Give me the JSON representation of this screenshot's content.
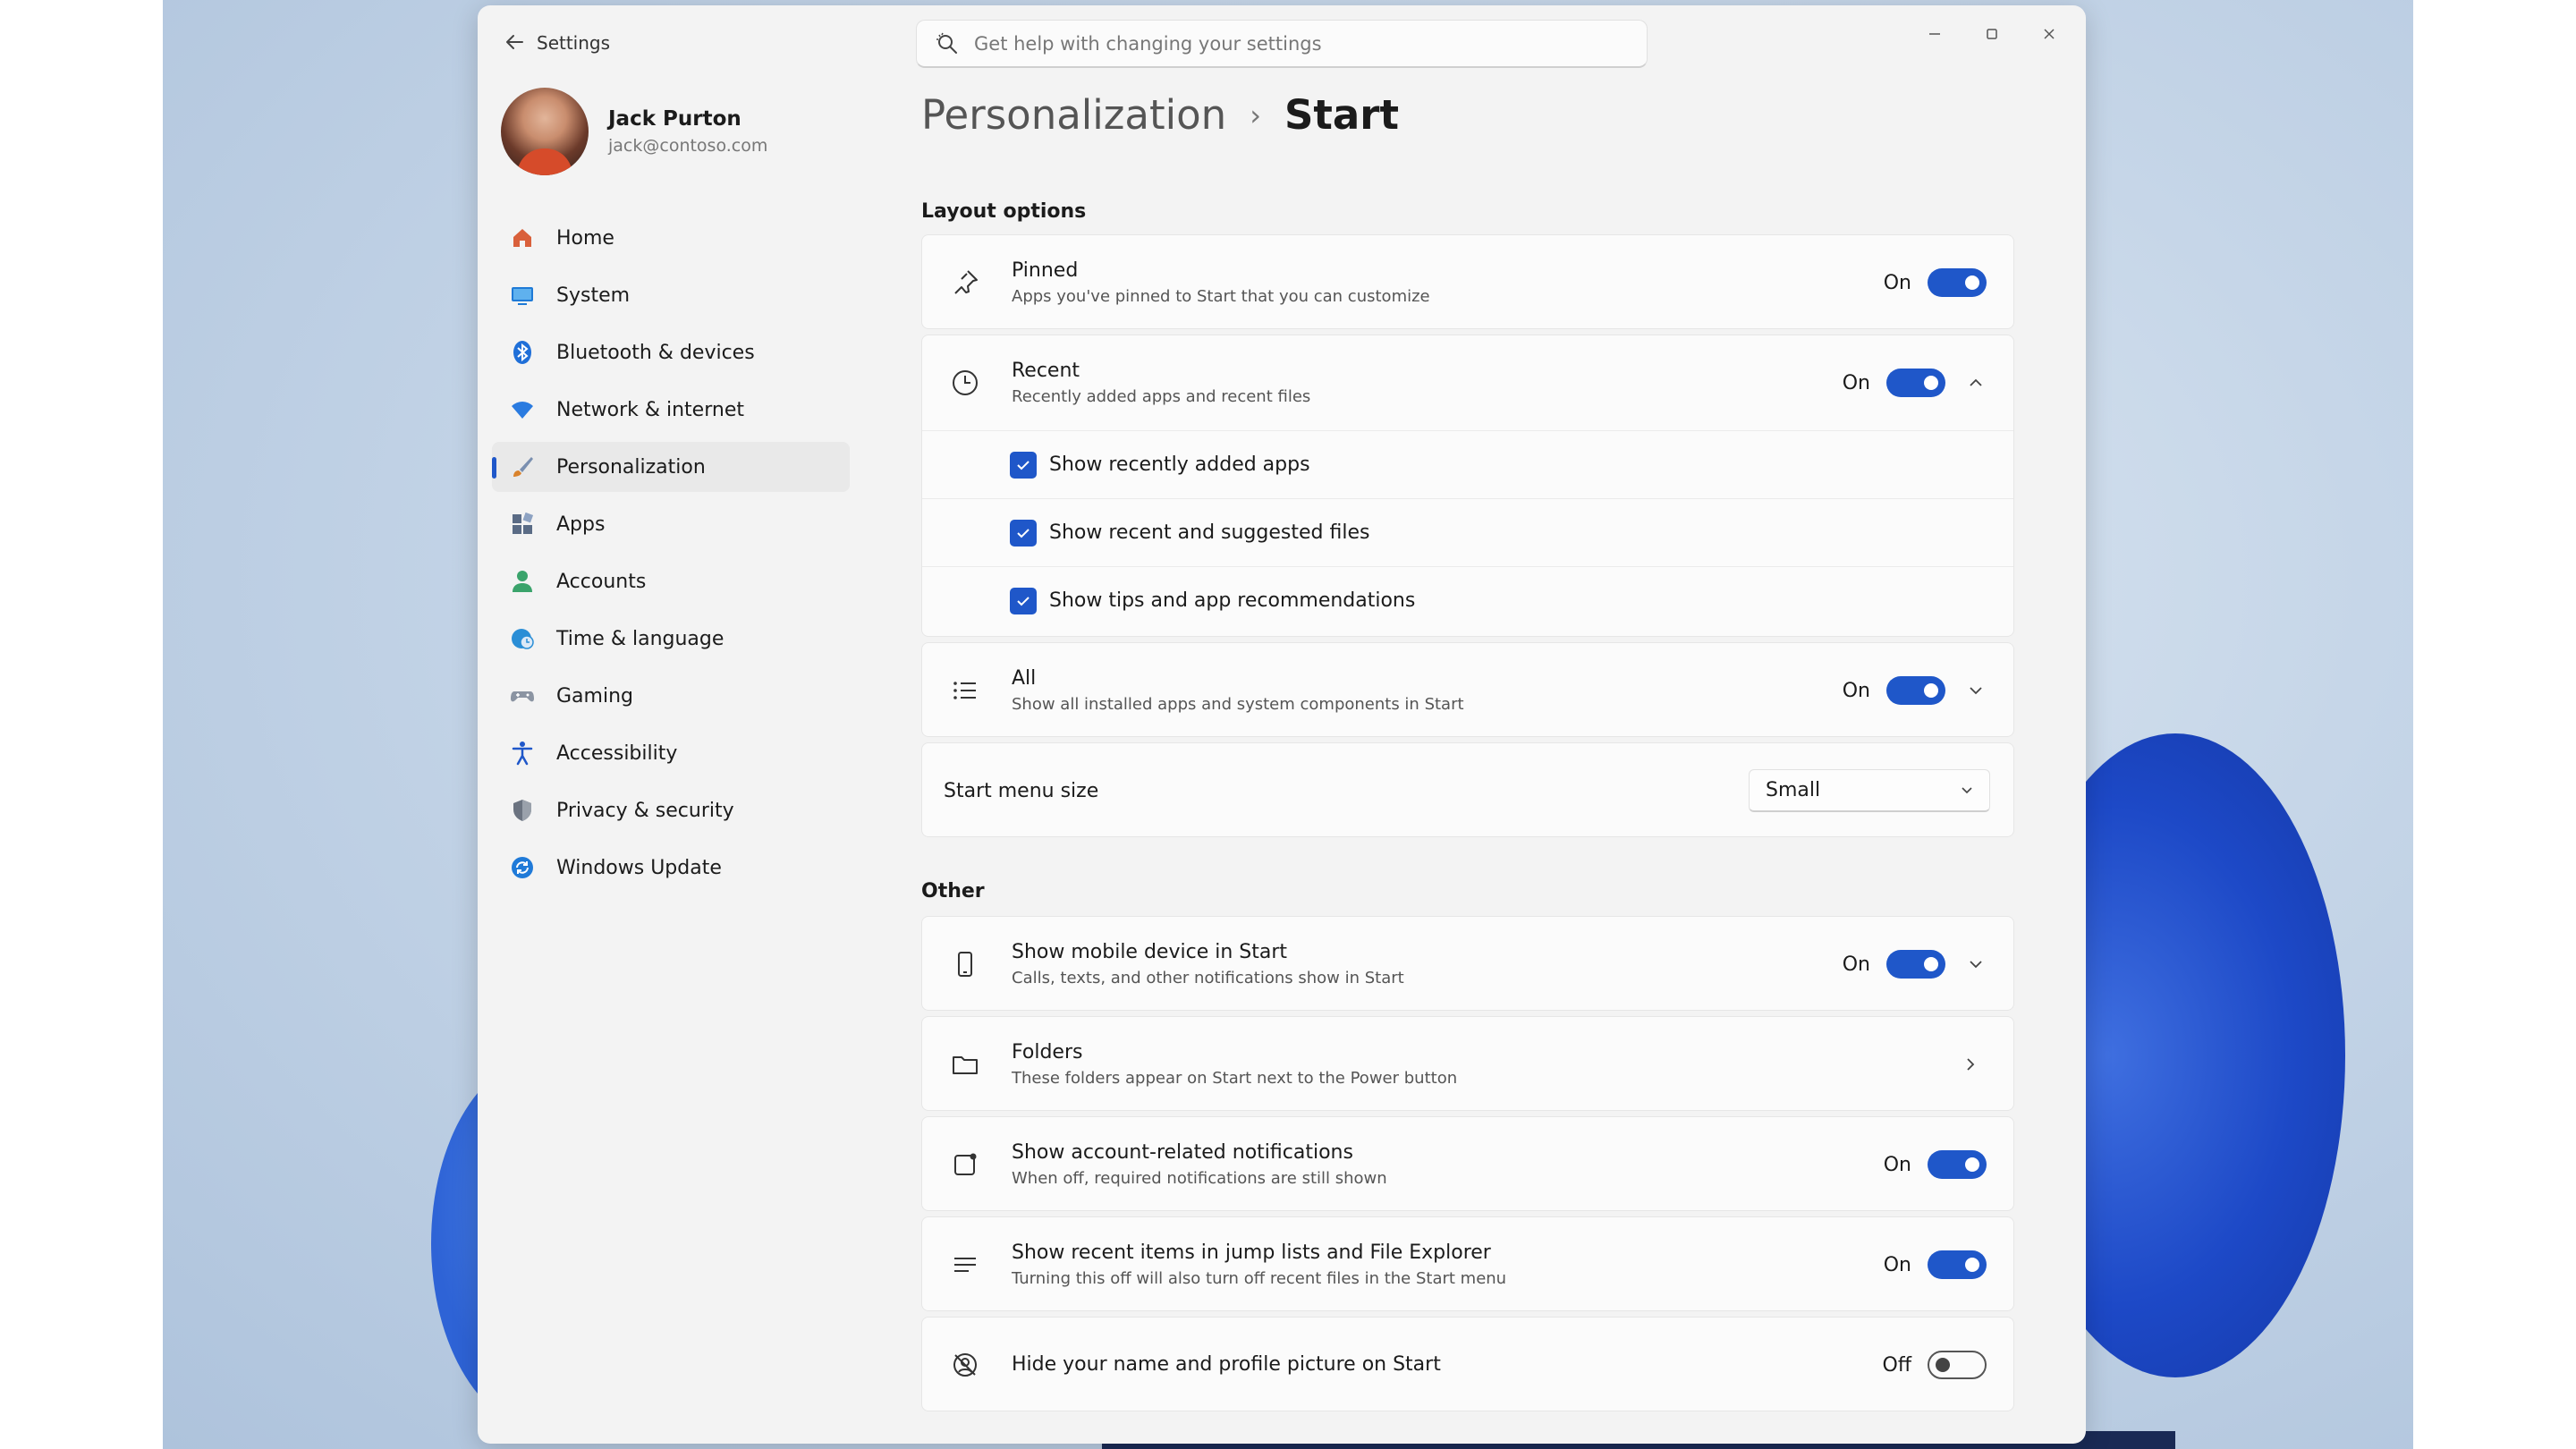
{
  "window": {
    "title": "Settings",
    "search_placeholder": "Get help with changing your settings"
  },
  "profile": {
    "name": "Jack Purton",
    "email": "jack@contoso.com"
  },
  "sidebar": {
    "items": [
      {
        "label": "Home",
        "icon": "home-icon",
        "color": "#d9603b"
      },
      {
        "label": "System",
        "icon": "system-icon",
        "color": "#1e7ad6"
      },
      {
        "label": "Bluetooth & devices",
        "icon": "bluetooth-icon",
        "color": "#1f6fd8"
      },
      {
        "label": "Network & internet",
        "icon": "wifi-icon",
        "color": "#2a7be0"
      },
      {
        "label": "Personalization",
        "icon": "brush-icon",
        "color": "#d9822b",
        "selected": true
      },
      {
        "label": "Apps",
        "icon": "apps-icon",
        "color": "#5a6b85"
      },
      {
        "label": "Accounts",
        "icon": "accounts-icon",
        "color": "#3aa36b"
      },
      {
        "label": "Time & language",
        "icon": "globe-clock-icon",
        "color": "#2a8ed6"
      },
      {
        "label": "Gaming",
        "icon": "gamepad-icon",
        "color": "#7b8594"
      },
      {
        "label": "Accessibility",
        "icon": "accessibility-icon",
        "color": "#1f57c9"
      },
      {
        "label": "Privacy & security",
        "icon": "shield-icon",
        "color": "#6b7380"
      },
      {
        "label": "Windows Update",
        "icon": "update-icon",
        "color": "#1f7ad8"
      }
    ]
  },
  "breadcrumb": {
    "parent": "Personalization",
    "separator": "›",
    "current": "Start"
  },
  "layout_options": {
    "title": "Layout options",
    "pinned": {
      "title": "Pinned",
      "desc": "Apps you've pinned to Start that you can customize",
      "state": "On"
    },
    "recent": {
      "title": "Recent",
      "desc": "Recently added apps and recent files",
      "state": "On",
      "options": [
        {
          "label": "Show recently added apps",
          "checked": true
        },
        {
          "label": "Show recent and suggested files",
          "checked": true
        },
        {
          "label": "Show tips and app recommendations",
          "checked": true
        }
      ]
    },
    "all": {
      "title": "All",
      "desc": "Show all installed apps and system components in Start",
      "state": "On"
    },
    "menu_size": {
      "label": "Start menu size",
      "value": "Small"
    }
  },
  "other": {
    "title": "Other",
    "mobile": {
      "title": "Show mobile device in Start",
      "desc": "Calls, texts, and other notifications show in Start",
      "state": "On"
    },
    "folders": {
      "title": "Folders",
      "desc": "These folders appear on Start next to the Power button"
    },
    "account_notifications": {
      "title": "Show account-related notifications",
      "desc": "When off, required notifications are still shown",
      "state": "On"
    },
    "jump_lists": {
      "title": "Show recent items in jump lists and File Explorer",
      "desc": "Turning this off will also turn off recent files in the Start menu",
      "state": "On"
    },
    "hide_profile": {
      "title": "Hide your name and profile picture on Start",
      "state": "Off"
    }
  },
  "colors": {
    "accent": "#1f57c9"
  }
}
